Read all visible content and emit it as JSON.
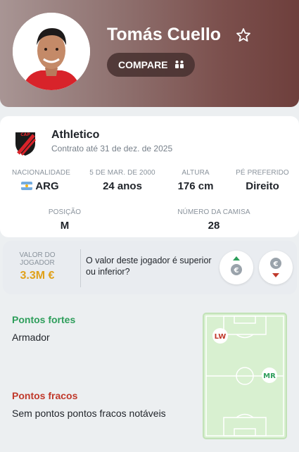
{
  "player": {
    "name": "Tomás Cuello",
    "compare_label": "COMPARE"
  },
  "club": {
    "name": "Athletico",
    "contract": "Contrato até 31 de dez. de 2025"
  },
  "stats": [
    {
      "label": "NACIONALIDADE",
      "value": "ARG"
    },
    {
      "label": "5 DE MAR. DE 2000",
      "value": "24 anos"
    },
    {
      "label": "ALTURA",
      "value": "176 cm"
    },
    {
      "label": "PÉ PREFERIDO",
      "value": "Direito"
    },
    {
      "label": "POSIÇÃO",
      "value": "M"
    },
    {
      "label": "NÚMERO DA CAMISA",
      "value": "28"
    }
  ],
  "market_value": {
    "label": "VALOR DO JOGADOR",
    "value": "3.3M €",
    "question": "O valor deste jogador é superior ou inferior?"
  },
  "attributes": {
    "strengths_title": "Pontos fortes",
    "strengths": [
      "Armador"
    ],
    "weaknesses_title": "Pontos fracos",
    "weaknesses": [
      "Sem pontos pontos fracos notáveis"
    ]
  },
  "positions": {
    "primary": "LW",
    "secondary": "MR"
  },
  "colors": {
    "header_accent": "#7b4f4c",
    "value_gold": "#e0a11b",
    "strength_green": "#2e9e5b",
    "weakness_red": "#c0392b",
    "pitch_green": "#d8f0d0"
  },
  "icons": {
    "favorite": "star-outline-icon",
    "compare": "compare-icon",
    "vote_up": "euro-arrow-up-icon",
    "vote_down": "euro-arrow-down-icon"
  }
}
